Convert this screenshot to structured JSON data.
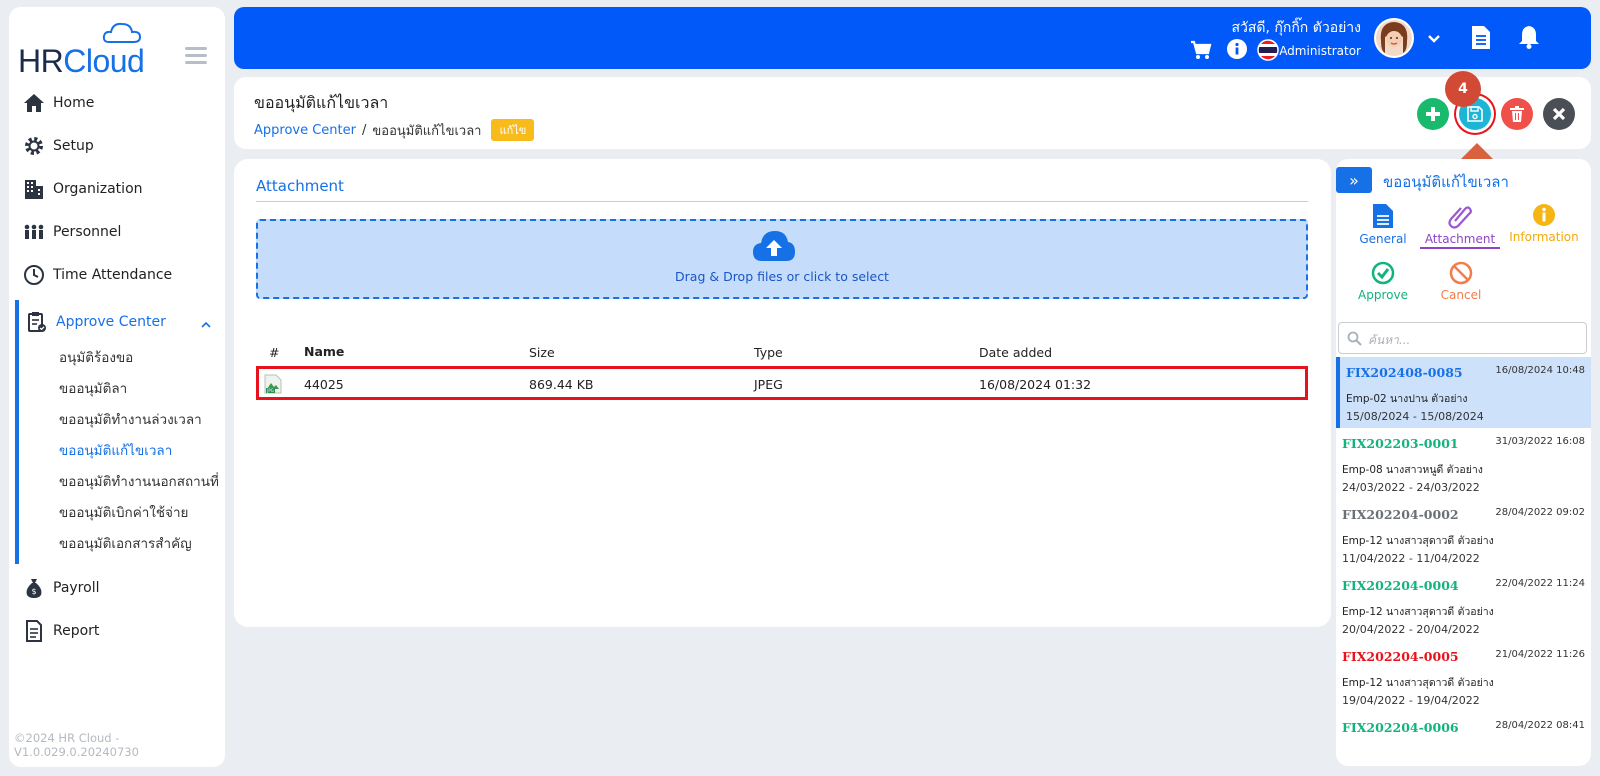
{
  "app": {
    "logo_hr": "HR",
    "logo_cloud": "Cloud",
    "footer": "©2024  HR  Cloud  -V1.0.029.0.20240730"
  },
  "nav": {
    "items": [
      {
        "label": "Home",
        "icon": "home-icon"
      },
      {
        "label": "Setup",
        "icon": "gear-icon"
      },
      {
        "label": "Organization",
        "icon": "building-icon"
      },
      {
        "label": "Personnel",
        "icon": "people-icon"
      },
      {
        "label": "Time Attendance",
        "icon": "clock-icon"
      }
    ],
    "group": {
      "label": "Approve Center",
      "sub": [
        "อนุมัติร้องขอ",
        "ขออนุมัติลา",
        "ขออนุมัติทำงานล่วงเวลา",
        "ขออนุมัติแก้ไขเวลา",
        "ขออนุมัติทำงานนอกสถานที่",
        "ขออนุมัติเบิกค่าใช้จ่าย",
        "ขออนุมัติเอกสารสำคัญ"
      ]
    },
    "bottom": [
      {
        "label": "Payroll",
        "icon": "money-bag-icon"
      },
      {
        "label": "Report",
        "icon": "report-icon"
      }
    ]
  },
  "header": {
    "greeting": "สวัสดี, กุ๊กกิ๊ก ตัวอย่าง",
    "role": "Administrator"
  },
  "page": {
    "title": "ขออนุมัติแก้ไขเวลา",
    "breadcrumb_link": "Approve Center",
    "breadcrumb_sep": "/",
    "breadcrumb_current": "ขออนุมัติแก้ไขเวลา",
    "badge": "แก้ไข",
    "annotation_step": "4"
  },
  "attachment": {
    "section_title": "Attachment",
    "dropzone_text": "Drag & Drop files or click to select",
    "columns": [
      "#",
      "Name",
      "Size",
      "Type",
      "Date added"
    ],
    "row": {
      "name": "44025",
      "size": "869.44 KB",
      "type": "JPEG",
      "date": "16/08/2024 01:32"
    }
  },
  "right_panel": {
    "title": "ขออนุมัติแก้ไขเวลา",
    "tabs": {
      "general": "General",
      "attachment": "Attachment",
      "information": "Information",
      "approve": "Approve",
      "cancel": "Cancel"
    },
    "search_placeholder": "ค้นหา...",
    "list": [
      {
        "code": "FIX202408-0085",
        "ts": "16/08/2024 10:48",
        "emp": "Emp-02 นางปาน ตัวอย่าง",
        "range": "15/08/2024 - 15/08/2024",
        "color": "#1670e6"
      },
      {
        "code": "FIX202203-0001",
        "ts": "31/03/2022 16:08",
        "emp": "Emp-08 นางสาวหนูดี ตัวอย่าง",
        "range": "24/03/2022 - 24/03/2022",
        "color": "#12b37c"
      },
      {
        "code": "FIX202204-0002",
        "ts": "28/04/2022 09:02",
        "emp": "Emp-12 นางสาวสุดาวดี ตัวอย่าง",
        "range": "11/04/2022 - 11/04/2022",
        "color": "#6b6f76"
      },
      {
        "code": "FIX202204-0004",
        "ts": "22/04/2022 11:24",
        "emp": "Emp-12 นางสาวสุดาวดี ตัวอย่าง",
        "range": "20/04/2022 - 20/04/2022",
        "color": "#12b37c"
      },
      {
        "code": "FIX202204-0005",
        "ts": "21/04/2022 11:26",
        "emp": "Emp-12 นางสาวสุดาวดี ตัวอย่าง",
        "range": "19/04/2022 - 19/04/2022",
        "color": "#e8121d"
      },
      {
        "code": "FIX202204-0006",
        "ts": "28/04/2022 08:41",
        "emp": "",
        "range": "",
        "color": "#12b37c"
      }
    ]
  },
  "colors": {
    "primary": "#1670e6",
    "header": "#0059f8",
    "add": "#19b96e",
    "save": "#1db5d6",
    "delete": "#f0504a",
    "close": "#4a4f55",
    "highlight": "#e8121d"
  }
}
